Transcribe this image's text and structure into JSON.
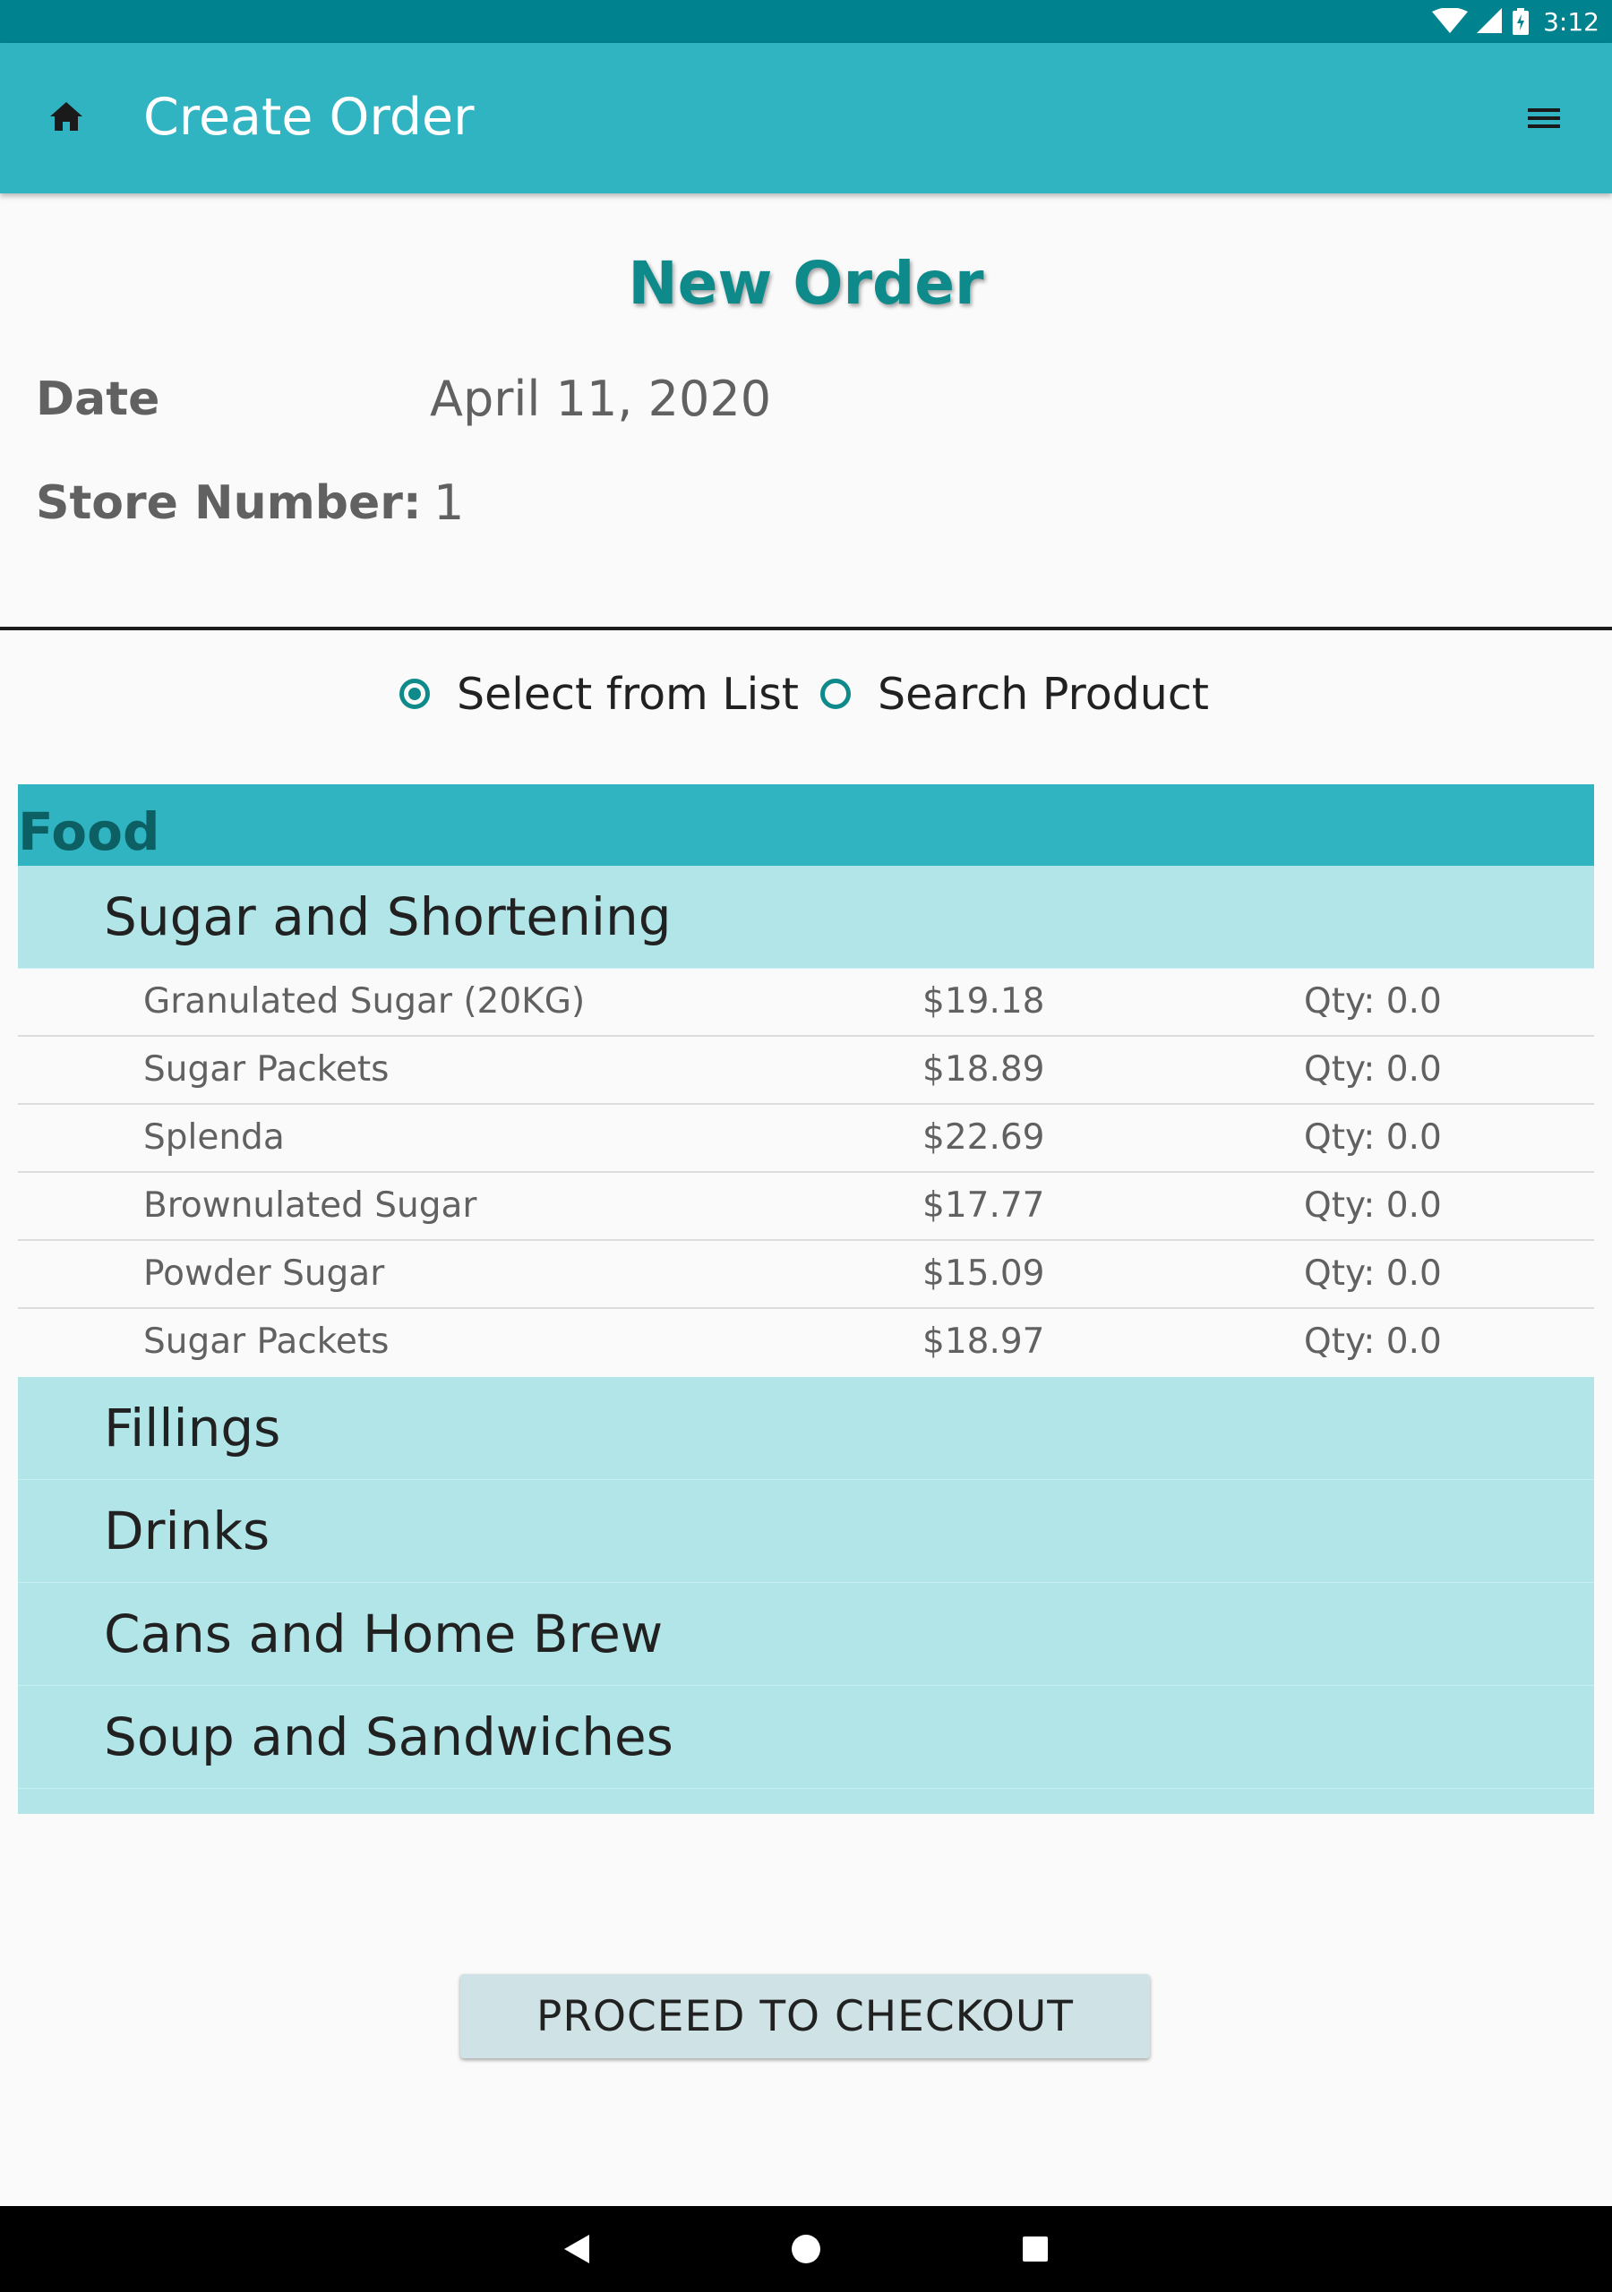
{
  "status_bar": {
    "time": "3:12",
    "icons": [
      "wifi-icon",
      "signal-icon",
      "battery-icon"
    ]
  },
  "app_bar": {
    "title": "Create Order",
    "left_icon": "home-icon",
    "right_icon": "menu-icon"
  },
  "header": {
    "heading": "New Order",
    "date_label": "Date",
    "date_value": "April 11, 2020",
    "store_label": "Store Number:",
    "store_value": "1"
  },
  "mode": {
    "options": [
      {
        "label": "Select from List",
        "selected": true
      },
      {
        "label": "Search Product",
        "selected": false
      }
    ]
  },
  "list": {
    "group": "Food",
    "expanded_category": "Sugar and Shortening",
    "items": [
      {
        "name": "Granulated Sugar (20KG)",
        "price": "$19.18",
        "qty": "Qty: 0.0"
      },
      {
        "name": "Sugar Packets",
        "price": "$18.89",
        "qty": "Qty: 0.0"
      },
      {
        "name": "Splenda",
        "price": "$22.69",
        "qty": "Qty: 0.0"
      },
      {
        "name": "Brownulated Sugar",
        "price": "$17.77",
        "qty": "Qty: 0.0"
      },
      {
        "name": "Powder Sugar",
        "price": "$15.09",
        "qty": "Qty: 0.0"
      },
      {
        "name": "Sugar Packets",
        "price": "$18.97",
        "qty": "Qty: 0.0"
      }
    ],
    "collapsed_categories": [
      "Fillings",
      "Drinks",
      "Cans and Home Brew",
      "Soup and Sandwiches"
    ]
  },
  "checkout_button": "PROCEED TO CHECKOUT",
  "colors": {
    "status_bar": "#00838f",
    "app_bar": "#30b4c2",
    "accent": "#0e8a8a",
    "category_bg": "#b2e5e8",
    "button_bg": "#cfe3e6"
  }
}
